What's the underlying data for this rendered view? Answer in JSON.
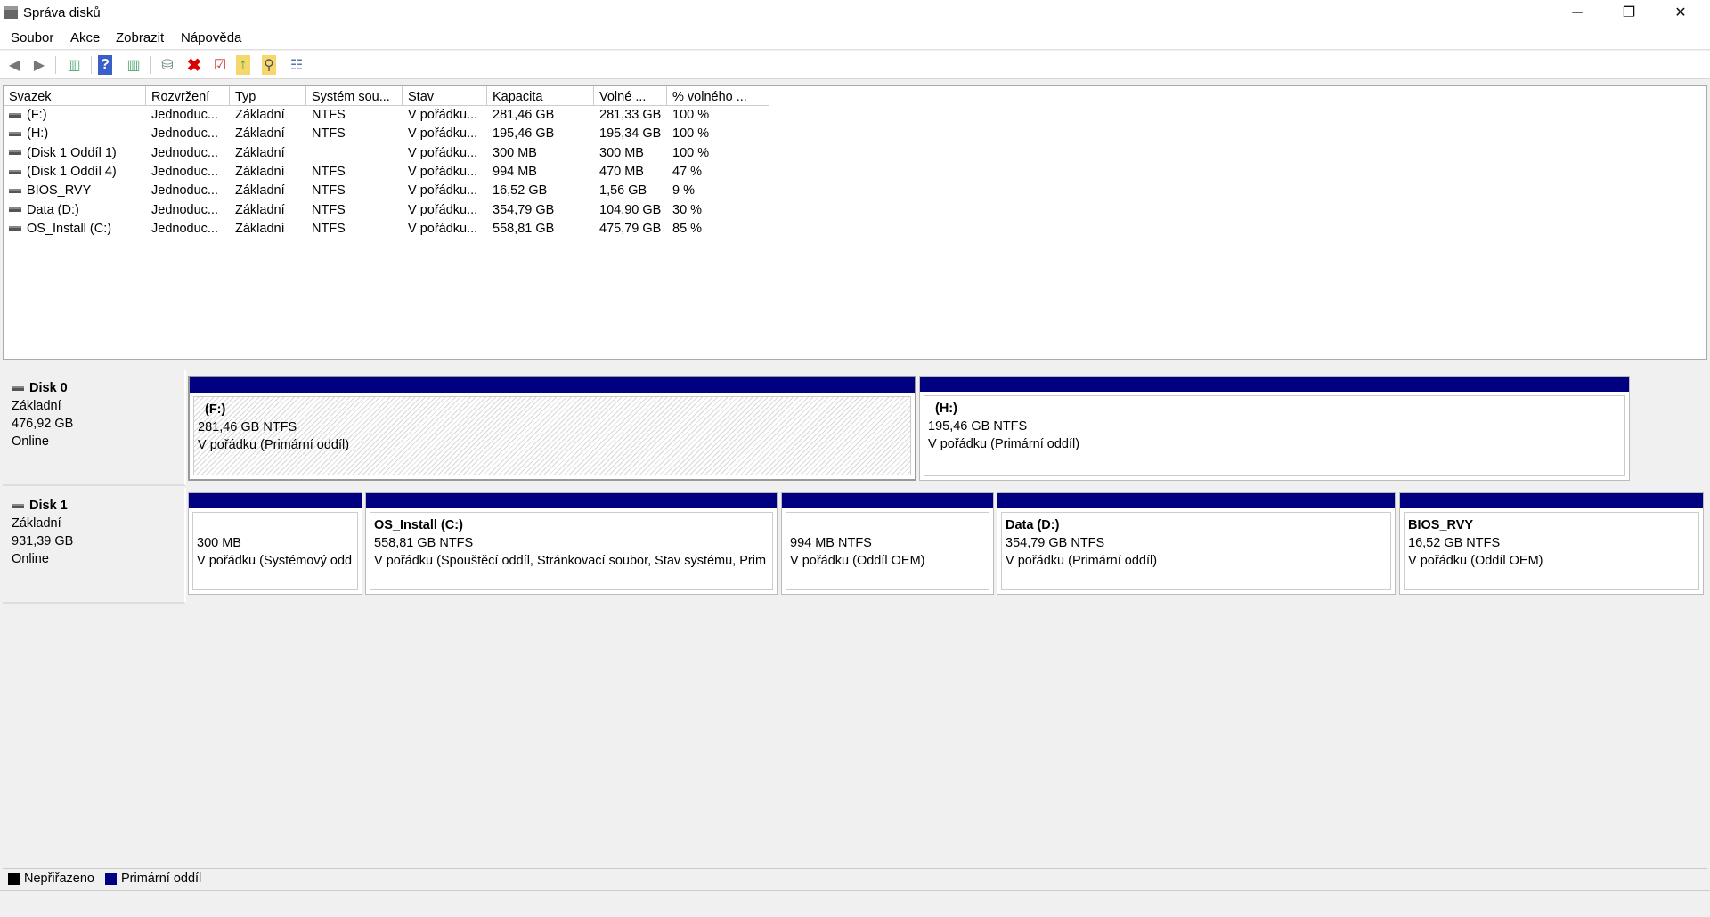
{
  "window": {
    "title": "Správa disků",
    "minimize": "─",
    "restore": "❐",
    "close": "✕"
  },
  "menu": [
    "Soubor",
    "Akce",
    "Zobrazit",
    "Nápověda"
  ],
  "toolbar": {
    "icons": [
      "back-icon",
      "forward-icon",
      "console-tree-icon",
      "help-icon",
      "action-pane-icon",
      "connect-icon",
      "delete-icon",
      "check-icon",
      "open-folder-icon",
      "search-icon",
      "properties-icon"
    ]
  },
  "table": {
    "columns": [
      "Svazek",
      "Rozvržení",
      "Typ",
      "Systém sou...",
      "Stav",
      "Kapacita",
      "Volné ...",
      "% volného ..."
    ],
    "rows": [
      [
        "(F:)",
        "Jednoduc...",
        "Základní",
        "NTFS",
        "V pořádku...",
        "281,46 GB",
        "281,33 GB",
        "100 %"
      ],
      [
        "(H:)",
        "Jednoduc...",
        "Základní",
        "NTFS",
        "V pořádku...",
        "195,46 GB",
        "195,34 GB",
        "100 %"
      ],
      [
        "(Disk 1 Oddíl 1)",
        "Jednoduc...",
        "Základní",
        "",
        "V pořádku...",
        "300 MB",
        "300 MB",
        "100 %"
      ],
      [
        "(Disk 1 Oddíl 4)",
        "Jednoduc...",
        "Základní",
        "NTFS",
        "V pořádku...",
        "994 MB",
        "470 MB",
        "47 %"
      ],
      [
        "BIOS_RVY",
        "Jednoduc...",
        "Základní",
        "NTFS",
        "V pořádku...",
        "16,52 GB",
        "1,56 GB",
        "9 %"
      ],
      [
        "Data (D:)",
        "Jednoduc...",
        "Základní",
        "NTFS",
        "V pořádku...",
        "354,79 GB",
        "104,90 GB",
        "30 %"
      ],
      [
        "OS_Install (C:)",
        "Jednoduc...",
        "Základní",
        "NTFS",
        "V pořádku...",
        "558,81 GB",
        "475,79 GB",
        "85 %"
      ]
    ]
  },
  "disks": [
    {
      "name": "Disk 0",
      "type": "Základní",
      "size": "476,92 GB",
      "status": "Online",
      "partitions": [
        {
          "name": "(F:)",
          "size": "281,46 GB NTFS",
          "status": "V pořádku (Primární oddíl)",
          "selected": true
        },
        {
          "name": "(H:)",
          "size": "195,46 GB NTFS",
          "status": "V pořádku (Primární oddíl)"
        }
      ]
    },
    {
      "name": "Disk 1",
      "type": "Základní",
      "size": "931,39 GB",
      "status": "Online",
      "partitions": [
        {
          "name": "",
          "size": "300 MB",
          "status": "V pořádku (Systémový odd"
        },
        {
          "name": "OS_Install  (C:)",
          "size": "558,81 GB NTFS",
          "status": "V pořádku (Spouštěcí oddíl, Stránkovací soubor, Stav systému, Prim"
        },
        {
          "name": "",
          "size": "994 MB NTFS",
          "status": "V pořádku (Oddíl OEM)"
        },
        {
          "name": "Data  (D:)",
          "size": "354,79 GB NTFS",
          "status": "V pořádku (Primární oddíl)"
        },
        {
          "name": "BIOS_RVY",
          "size": "16,52 GB NTFS",
          "status": "V pořádku (Oddíl OEM)"
        }
      ]
    }
  ],
  "legend": [
    {
      "label": "Nepřiřazeno",
      "color": "#000000"
    },
    {
      "label": "Primární oddíl",
      "color": "#000080"
    }
  ]
}
